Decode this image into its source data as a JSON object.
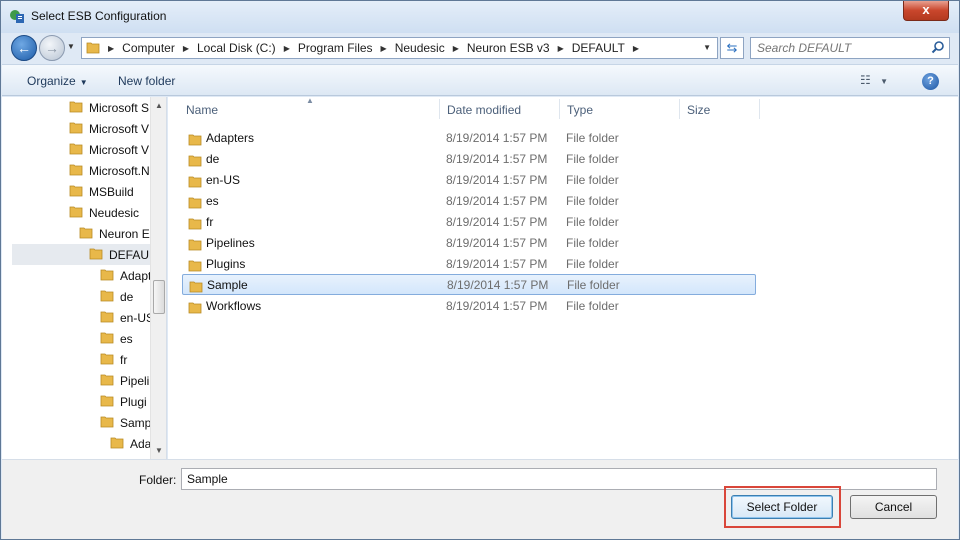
{
  "window": {
    "title": "Select ESB Configuration",
    "close_label": "x"
  },
  "nav": {
    "back_label": "←",
    "forward_label": "→"
  },
  "address": {
    "crumbs": [
      "Computer",
      "Local Disk (C:)",
      "Program Files",
      "Neudesic",
      "Neuron ESB v3",
      "DEFAULT"
    ]
  },
  "search": {
    "placeholder": "Search DEFAULT"
  },
  "toolbar": {
    "organize_label": "Organize",
    "new_folder_label": "New folder",
    "help_label": "?"
  },
  "tree": [
    {
      "label": "Microsoft S",
      "level": 0
    },
    {
      "label": "Microsoft V",
      "level": 0
    },
    {
      "label": "Microsoft V",
      "level": 0
    },
    {
      "label": "Microsoft.N",
      "level": 0
    },
    {
      "label": "MSBuild",
      "level": 0
    },
    {
      "label": "Neudesic",
      "level": 0
    },
    {
      "label": "Neuron E",
      "level": 1
    },
    {
      "label": "DEFAULI",
      "level": 2,
      "selected": true
    },
    {
      "label": "Adapt",
      "level": 3
    },
    {
      "label": "de",
      "level": 3
    },
    {
      "label": "en-US",
      "level": 3
    },
    {
      "label": "es",
      "level": 3
    },
    {
      "label": "fr",
      "level": 3
    },
    {
      "label": "Pipeli",
      "level": 3
    },
    {
      "label": "Plugi",
      "level": 3
    },
    {
      "label": "Samp",
      "level": 3
    },
    {
      "label": "Ada",
      "level": 4
    }
  ],
  "columns": {
    "name": "Name",
    "date": "Date modified",
    "type": "Type",
    "size": "Size"
  },
  "files": [
    {
      "name": "Adapters",
      "date": "8/19/2014 1:57 PM",
      "type": "File folder"
    },
    {
      "name": "de",
      "date": "8/19/2014 1:57 PM",
      "type": "File folder"
    },
    {
      "name": "en-US",
      "date": "8/19/2014 1:57 PM",
      "type": "File folder"
    },
    {
      "name": "es",
      "date": "8/19/2014 1:57 PM",
      "type": "File folder"
    },
    {
      "name": "fr",
      "date": "8/19/2014 1:57 PM",
      "type": "File folder"
    },
    {
      "name": "Pipelines",
      "date": "8/19/2014 1:57 PM",
      "type": "File folder"
    },
    {
      "name": "Plugins",
      "date": "8/19/2014 1:57 PM",
      "type": "File folder"
    },
    {
      "name": "Sample",
      "date": "8/19/2014 1:57 PM",
      "type": "File folder",
      "selected": true
    },
    {
      "name": "Workflows",
      "date": "8/19/2014 1:57 PM",
      "type": "File folder"
    }
  ],
  "footer": {
    "folder_label": "Folder:",
    "folder_value": "Sample",
    "select_label": "Select Folder",
    "cancel_label": "Cancel"
  },
  "colors": {
    "selection_border": "#84acdd",
    "highlight": "#d9463a",
    "folder_icon": "#e8b84a"
  },
  "icons": {
    "folder": "folder-icon",
    "search": "search-icon",
    "refresh": "refresh-icon",
    "views": "views-icon",
    "help": "help-icon"
  }
}
